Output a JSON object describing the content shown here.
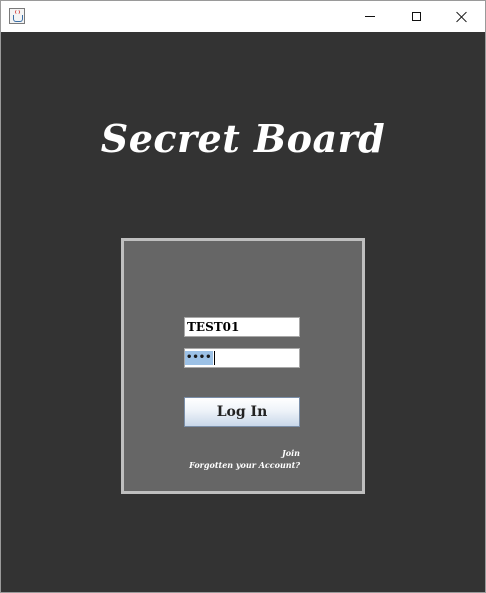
{
  "window": {
    "icon": "java-cup-icon",
    "controls": {
      "minimize": "minimize-icon",
      "maximize": "maximize-icon",
      "close": "close-icon"
    }
  },
  "app": {
    "title": "Secret Board",
    "colors": {
      "background": "#333333",
      "panel": "#666666",
      "panel_border": "#bfbfbf",
      "title_text": "#ffffff"
    }
  },
  "login": {
    "username_value": "TEST01",
    "password_mask": "••••",
    "login_label": "Log In",
    "join_label": "Join",
    "forgot_label": "Forgotten your Account?"
  }
}
